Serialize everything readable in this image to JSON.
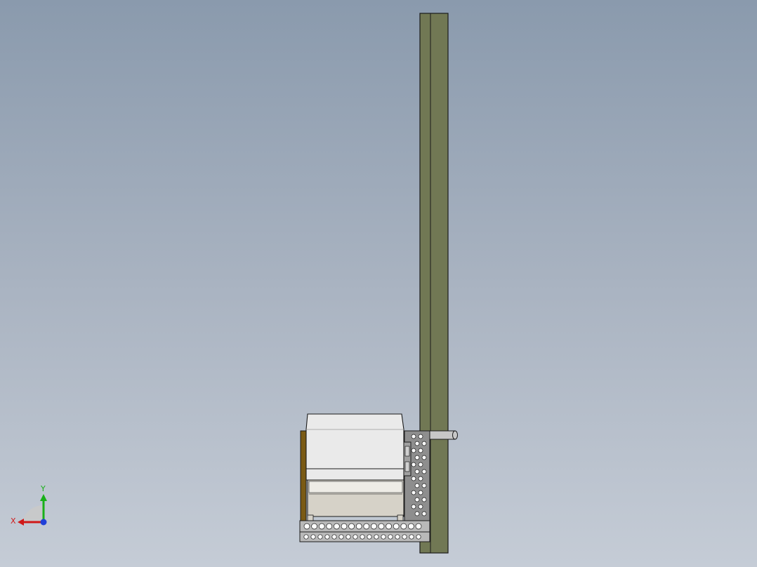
{
  "view": {
    "background_top": "#8a9aad",
    "background_bottom": "#c5ccd6"
  },
  "model": {
    "column_color": "#717854",
    "column_edge_color": "#1a1a1a",
    "panel_color": "#8e8e8e",
    "wood_color": "#7a5a14",
    "housing_color": "#eaeaea",
    "box_color": "#d6d2c8",
    "hole_count_row1": 16,
    "hole_count_row2": 17
  },
  "triad": {
    "x_label": "X",
    "y_label": "Y",
    "x_color": "#d01818",
    "y_color": "#18b018",
    "z_color": "#2040d8"
  }
}
